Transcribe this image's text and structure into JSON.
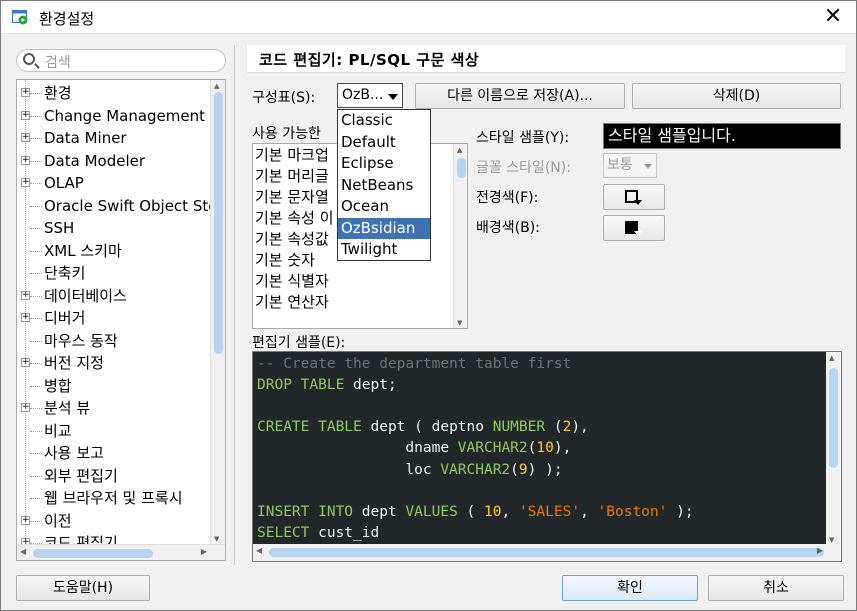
{
  "window": {
    "title": "환경설정",
    "close_label": "✕"
  },
  "search": {
    "placeholder": "검색"
  },
  "tree": {
    "items": [
      {
        "label": "환경",
        "expandable": true
      },
      {
        "label": "Change Management D",
        "expandable": true
      },
      {
        "label": "Data Miner",
        "expandable": true
      },
      {
        "label": "Data Modeler",
        "expandable": true
      },
      {
        "label": "OLAP",
        "expandable": true
      },
      {
        "label": "Oracle Swift Object Sto",
        "expandable": false
      },
      {
        "label": "SSH",
        "expandable": false
      },
      {
        "label": "XML 스키마",
        "expandable": false
      },
      {
        "label": "단축키",
        "expandable": false
      },
      {
        "label": "데이터베이스",
        "expandable": true
      },
      {
        "label": "디버거",
        "expandable": true
      },
      {
        "label": "마우스 동작",
        "expandable": false
      },
      {
        "label": "버전 지정",
        "expandable": true
      },
      {
        "label": "병합",
        "expandable": false
      },
      {
        "label": "분석 뷰",
        "expandable": true
      },
      {
        "label": "비교",
        "expandable": false
      },
      {
        "label": "사용 보고",
        "expandable": false
      },
      {
        "label": "외부 편집기",
        "expandable": false
      },
      {
        "label": "웹 브라우저 및 프록시",
        "expandable": false
      },
      {
        "label": "이전",
        "expandable": true
      },
      {
        "label": "코드 편집기",
        "expandable": true
      }
    ]
  },
  "panel": {
    "title": "코드 편집기: PL/SQL 구문 색상",
    "scheme_label": "구성표(S):",
    "scheme_value": "OzB...",
    "save_as_label": "다른 이름으로 저장(A)...",
    "delete_label": "삭제(D)",
    "available_label": "사용 가능한",
    "available_items": [
      "기본 마크업",
      "기본 머리글",
      "기본 문자열",
      "기본 속성 이",
      "기본 속성값",
      "기본 숫자",
      "기본 식별자",
      "기본 연산자"
    ],
    "scheme_options": [
      "Classic",
      "Default",
      "Eclipse",
      "NetBeans",
      "Ocean",
      "OzBsidian",
      "Twilight"
    ],
    "scheme_selected": "OzBsidian",
    "style_sample_label": "스타일 샘플(Y):",
    "style_sample_text": "스타일 샘플입니다.",
    "font_style_label": "글꼴 스타일(N):",
    "font_style_value": "보통",
    "foreground_label": "전경색(F):",
    "background_label": "배경색(B):",
    "editor_sample_label": "편집기 샘플(E):"
  },
  "code_lines": [
    [
      {
        "t": "-- Create the department table first",
        "c": "#66747b"
      }
    ],
    [
      {
        "t": "DROP TABLE",
        "c": "#93c763"
      },
      {
        "t": " dept;",
        "c": "#f1f2f3"
      }
    ],
    [],
    [
      {
        "t": "CREATE TABLE",
        "c": "#93c763"
      },
      {
        "t": " dept ( deptno ",
        "c": "#f1f2f3"
      },
      {
        "t": "NUMBER",
        "c": "#93c763"
      },
      {
        "t": " (",
        "c": "#f1f2f3"
      },
      {
        "t": "2",
        "c": "#ffcd22"
      },
      {
        "t": "),",
        "c": "#f1f2f3"
      }
    ],
    [
      {
        "t": "                 dname ",
        "c": "#f1f2f3"
      },
      {
        "t": "VARCHAR2",
        "c": "#93c763"
      },
      {
        "t": "(",
        "c": "#f1f2f3"
      },
      {
        "t": "10",
        "c": "#ffcd22"
      },
      {
        "t": "),",
        "c": "#f1f2f3"
      }
    ],
    [
      {
        "t": "                 loc ",
        "c": "#f1f2f3"
      },
      {
        "t": "VARCHAR2",
        "c": "#93c763"
      },
      {
        "t": "(",
        "c": "#f1f2f3"
      },
      {
        "t": "9",
        "c": "#ffcd22"
      },
      {
        "t": ") );",
        "c": "#f1f2f3"
      }
    ],
    [],
    [
      {
        "t": "INSERT INTO",
        "c": "#93c763"
      },
      {
        "t": " dept ",
        "c": "#f1f2f3"
      },
      {
        "t": "VALUES",
        "c": "#93c763"
      },
      {
        "t": " ( ",
        "c": "#f1f2f3"
      },
      {
        "t": "10",
        "c": "#ffcd22"
      },
      {
        "t": ", ",
        "c": "#f1f2f3"
      },
      {
        "t": "'SALES'",
        "c": "#ec7600"
      },
      {
        "t": ", ",
        "c": "#f1f2f3"
      },
      {
        "t": "'Boston'",
        "c": "#ec7600"
      },
      {
        "t": " );",
        "c": "#f1f2f3"
      }
    ],
    [
      {
        "t": "SELECT",
        "c": "#93c763"
      },
      {
        "t": " cust_id",
        "c": "#f1f2f3"
      }
    ]
  ],
  "footer": {
    "help_label": "도움말(H)",
    "ok_label": "확인",
    "cancel_label": "취소"
  },
  "colors": {
    "accent": "#3e72b3",
    "editor_bg": "#22282a"
  }
}
